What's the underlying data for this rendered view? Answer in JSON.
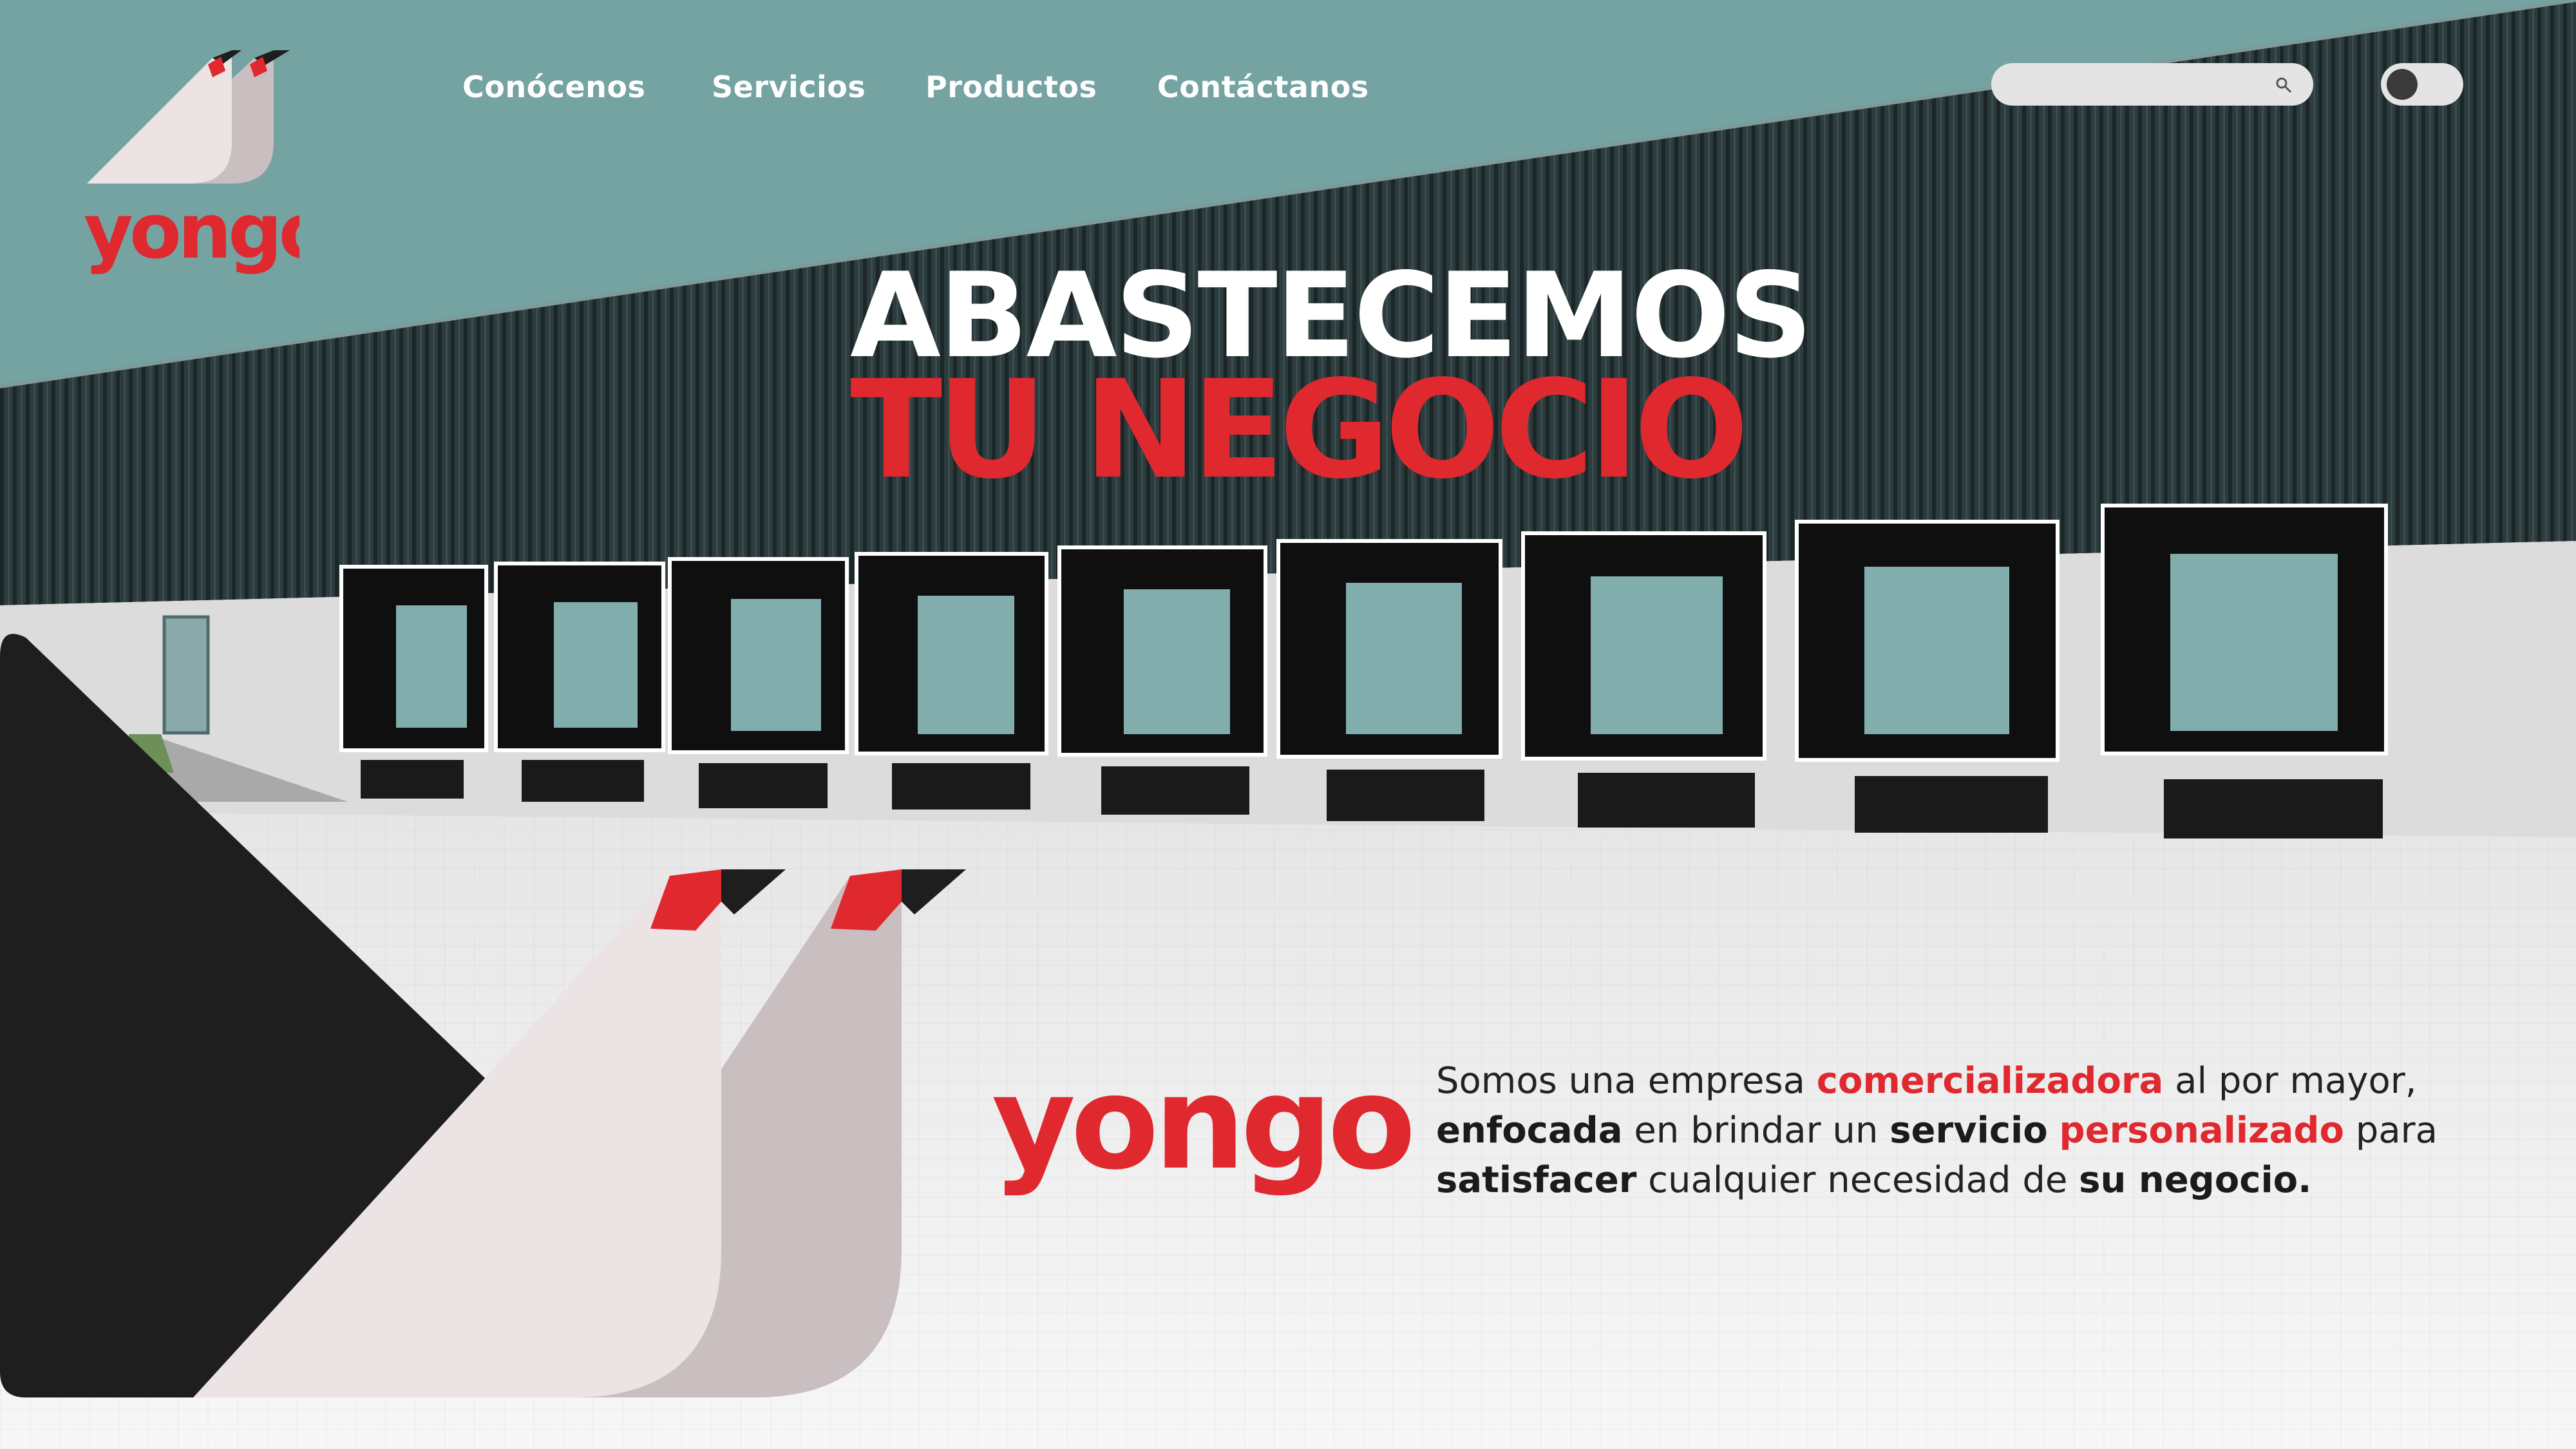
{
  "brand": {
    "name": "yongo",
    "colors": {
      "red": "#e0282f",
      "teal": "#74a3a2",
      "dark": "#1e1e1e",
      "light_bird": "#ebe3e4",
      "mid_bird": "#c9bec0"
    }
  },
  "nav": {
    "items": [
      {
        "label": "Conócenos"
      },
      {
        "label": "Servicios"
      },
      {
        "label": "Productos"
      },
      {
        "label": "Contáctanos"
      }
    ]
  },
  "search": {
    "placeholder": "",
    "icon": "search-icon"
  },
  "theme_toggle": {
    "state": "off"
  },
  "hero": {
    "line1": "ABASTECEMOS",
    "line2": "TU NEGOCIO"
  },
  "about": {
    "brand": "yongo",
    "segments": [
      {
        "text": "Somos una  empresa ",
        "style": "normal"
      },
      {
        "text": "comercializadora",
        "style": "red"
      },
      {
        "text": " al  por mayor, ",
        "style": "normal"
      },
      {
        "text": "enfocada",
        "style": "bold"
      },
      {
        "text": " en brindar un ",
        "style": "normal"
      },
      {
        "text": "servicio",
        "style": "bold"
      },
      {
        "text": " ",
        "style": "normal"
      },
      {
        "text": "personalizado",
        "style": "red"
      },
      {
        "text": " para ",
        "style": "normal"
      },
      {
        "text": "satisfacer",
        "style": "bold"
      },
      {
        "text": " cualquier necesidad de ",
        "style": "normal"
      },
      {
        "text": "su negocio.",
        "style": "bold"
      }
    ]
  }
}
